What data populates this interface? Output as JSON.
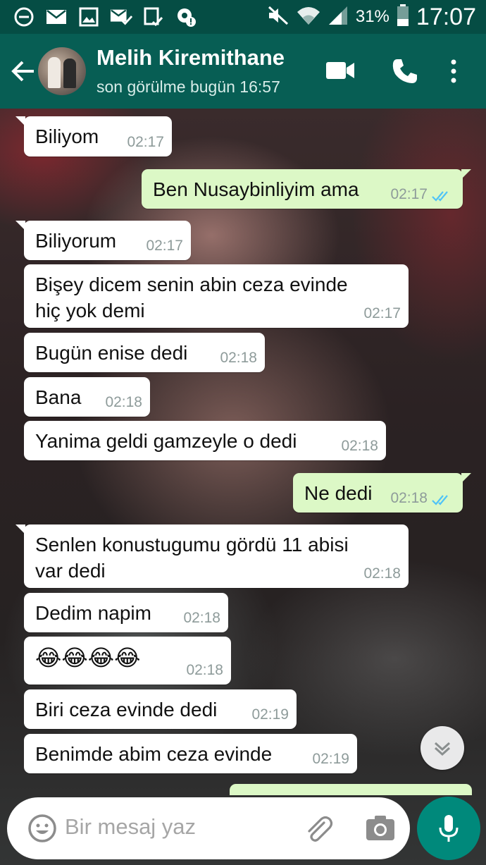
{
  "status_bar": {
    "time": "17:07",
    "battery_percent": "31%"
  },
  "header": {
    "contact_name": "Melih Kiremithane",
    "last_seen": "son görülme bugün 16:57"
  },
  "messages": [
    {
      "direction": "in",
      "text": "Biliyom",
      "time": "02:17"
    },
    {
      "direction": "out",
      "text": "Ben Nusaybinliyim ama",
      "time": "02:17",
      "status": "read"
    },
    {
      "direction": "in",
      "text": "Biliyorum",
      "time": "02:17"
    },
    {
      "direction": "in",
      "text": "Bişey dicem senin abin ceza evinde\nhiç yok demi",
      "time": "02:17"
    },
    {
      "direction": "in",
      "text": "Bugün enise dedi",
      "time": "02:18"
    },
    {
      "direction": "in",
      "text": "Bana",
      "time": "02:18"
    },
    {
      "direction": "in",
      "text": "Yanima geldi gamzeyle o dedi",
      "time": "02:18"
    },
    {
      "direction": "out",
      "text": "Ne dedi",
      "time": "02:18",
      "status": "read"
    },
    {
      "direction": "in",
      "text": "Senlen konustugumu gördü 11 abisi\nvar dedi",
      "time": "02:18"
    },
    {
      "direction": "in",
      "text": "Dedim napim",
      "time": "02:18"
    },
    {
      "direction": "in",
      "text": "😂😂😂😂",
      "time": "02:18"
    },
    {
      "direction": "in",
      "text": "Biri ceza evinde dedi",
      "time": "02:19"
    },
    {
      "direction": "in",
      "text": "Benimde abim ceza evinde",
      "time": "02:19"
    }
  ],
  "input": {
    "placeholder": "Bir mesaj yaz"
  },
  "colors": {
    "header": "#075e54",
    "status_bar": "#054d44",
    "outgoing_bubble": "#dcf8c6",
    "incoming_bubble": "#ffffff",
    "accent": "#00897b",
    "read_ticks": "#4fc3f7"
  },
  "icons": [
    "do-not-disturb-icon",
    "mail-icon",
    "image-icon",
    "mail-check-icon",
    "clipboard-check-icon",
    "settings-alert-icon",
    "mute-icon",
    "wifi-icon",
    "signal-icon",
    "battery-icon",
    "back-arrow-icon",
    "video-call-icon",
    "phone-icon",
    "more-options-icon",
    "double-chevron-down-icon",
    "emoji-icon",
    "paperclip-icon",
    "camera-icon",
    "microphone-icon"
  ]
}
